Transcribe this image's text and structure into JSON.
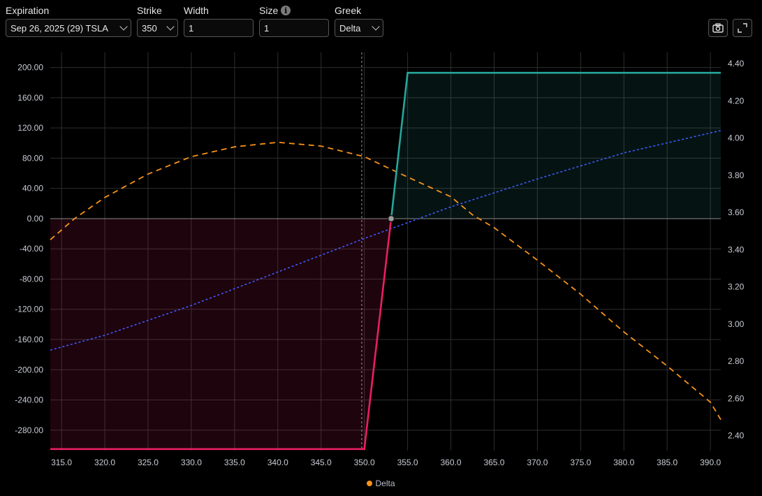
{
  "controls": {
    "expiration": {
      "label": "Expiration",
      "value": "Sep 26, 2025 (29) TSLA"
    },
    "strike": {
      "label": "Strike",
      "value": "350"
    },
    "width": {
      "label": "Width",
      "value": "1"
    },
    "size": {
      "label": "Size",
      "value": "1"
    },
    "greek": {
      "label": "Greek",
      "value": "Delta"
    },
    "camera_icon": "camera-icon",
    "expand_icon": "expand-icon"
  },
  "legend": {
    "label": "Delta",
    "color": "#f7931a"
  },
  "chart_data": {
    "type": "line",
    "x_ticks": [
      "315.0",
      "320.0",
      "325.0",
      "330.0",
      "335.0",
      "340.0",
      "345.0",
      "350.0",
      "355.0",
      "360.0",
      "365.0",
      "370.0",
      "375.0",
      "380.0",
      "385.0",
      "390.0"
    ],
    "y_left_ticks": [
      "200.00",
      "160.00",
      "120.00",
      "80.00",
      "40.00",
      "0.00",
      "-40.00",
      "-80.00",
      "-120.00",
      "-160.00",
      "-200.00",
      "-240.00",
      "-280.00"
    ],
    "y_right_ticks": [
      "4.40",
      "4.20",
      "4.00",
      "3.80",
      "3.60",
      "3.40",
      "3.20",
      "3.00",
      "2.80",
      "2.60",
      "2.40"
    ],
    "xlim": [
      313.7,
      391.2
    ],
    "ylim_left": [
      -307,
      220
    ],
    "ylim_right": [
      2.32,
      4.46
    ],
    "vertical_marker_x": 349.7,
    "breakeven": {
      "x": 353.1,
      "y": 0
    },
    "series": [
      {
        "role": "payoff",
        "color_loss": "#e91e63",
        "color_profit": "#26a69a",
        "x": [
          313.7,
          350.0,
          353.1,
          355.0,
          391.2
        ],
        "y": [
          -305,
          -305,
          0,
          193,
          193
        ]
      },
      {
        "name": "Delta",
        "color": "#f7931a",
        "axis": "left",
        "x": [
          313.7,
          316.5,
          320,
          325,
          330,
          335,
          340,
          345,
          350,
          355,
          360,
          362.5,
          365,
          370,
          375,
          380,
          385,
          390,
          391.2
        ],
        "y": [
          -28,
          0,
          28,
          59,
          82,
          95,
          101,
          96,
          82,
          55,
          29,
          5,
          -12,
          -55,
          -100,
          -150,
          -195,
          -243,
          -266
        ]
      },
      {
        "role": "value",
        "color": "#3d5afe",
        "axis": "right",
        "x": [
          313.7,
          320,
          330,
          340,
          350,
          360,
          370,
          380,
          391.2
        ],
        "y": [
          2.86,
          2.94,
          3.1,
          3.28,
          3.46,
          3.63,
          3.78,
          3.92,
          4.04
        ]
      }
    ]
  }
}
